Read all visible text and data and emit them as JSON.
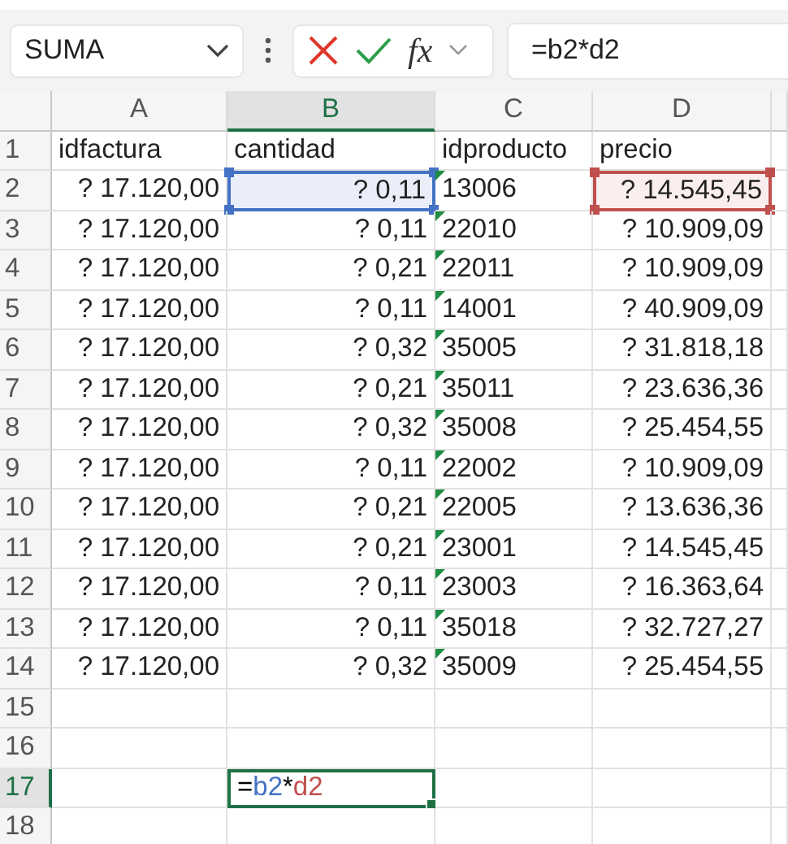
{
  "toolbar": {
    "name_box": "SUMA",
    "function_label": "fx",
    "formula": "=b2*d2"
  },
  "columns": [
    {
      "label": "A",
      "selected": false
    },
    {
      "label": "B",
      "selected": true
    },
    {
      "label": "C",
      "selected": false
    },
    {
      "label": "D",
      "selected": false
    }
  ],
  "rows": [
    {
      "header": "1",
      "selected": false,
      "cells": [
        {
          "text": "idfactura",
          "kind": "text"
        },
        {
          "text": "cantidad",
          "kind": "text"
        },
        {
          "text": "idproducto",
          "kind": "text"
        },
        {
          "text": "precio",
          "kind": "text"
        }
      ]
    },
    {
      "header": "2",
      "selected": false,
      "cells": [
        {
          "text": "? 17.120,00",
          "kind": "number"
        },
        {
          "text": "? 0,11",
          "kind": "number",
          "color": "#4472c4"
        },
        {
          "text": "13006",
          "kind": "text",
          "flag": true
        },
        {
          "text": "? 14.545,45",
          "kind": "number",
          "color": "#c0504d"
        }
      ]
    },
    {
      "header": "3",
      "selected": false,
      "cells": [
        {
          "text": "? 17.120,00",
          "kind": "number"
        },
        {
          "text": "? 0,11",
          "kind": "number"
        },
        {
          "text": "22010",
          "kind": "text",
          "flag": true
        },
        {
          "text": "? 10.909,09",
          "kind": "number"
        }
      ]
    },
    {
      "header": "4",
      "selected": false,
      "cells": [
        {
          "text": "? 17.120,00",
          "kind": "number"
        },
        {
          "text": "? 0,21",
          "kind": "number"
        },
        {
          "text": "22011",
          "kind": "text",
          "flag": true
        },
        {
          "text": "? 10.909,09",
          "kind": "number"
        }
      ]
    },
    {
      "header": "5",
      "selected": false,
      "cells": [
        {
          "text": "? 17.120,00",
          "kind": "number"
        },
        {
          "text": "? 0,11",
          "kind": "number"
        },
        {
          "text": "14001",
          "kind": "text",
          "flag": true
        },
        {
          "text": "? 40.909,09",
          "kind": "number"
        }
      ]
    },
    {
      "header": "6",
      "selected": false,
      "cells": [
        {
          "text": "? 17.120,00",
          "kind": "number"
        },
        {
          "text": "? 0,32",
          "kind": "number"
        },
        {
          "text": "35005",
          "kind": "text",
          "flag": true
        },
        {
          "text": "? 31.818,18",
          "kind": "number"
        }
      ]
    },
    {
      "header": "7",
      "selected": false,
      "cells": [
        {
          "text": "? 17.120,00",
          "kind": "number"
        },
        {
          "text": "? 0,21",
          "kind": "number"
        },
        {
          "text": "35011",
          "kind": "text",
          "flag": true
        },
        {
          "text": "? 23.636,36",
          "kind": "number"
        }
      ]
    },
    {
      "header": "8",
      "selected": false,
      "cells": [
        {
          "text": "? 17.120,00",
          "kind": "number"
        },
        {
          "text": "? 0,32",
          "kind": "number"
        },
        {
          "text": "35008",
          "kind": "text",
          "flag": true
        },
        {
          "text": "? 25.454,55",
          "kind": "number"
        }
      ]
    },
    {
      "header": "9",
      "selected": false,
      "cells": [
        {
          "text": "? 17.120,00",
          "kind": "number"
        },
        {
          "text": "? 0,11",
          "kind": "number"
        },
        {
          "text": "22002",
          "kind": "text",
          "flag": true
        },
        {
          "text": "? 10.909,09",
          "kind": "number"
        }
      ]
    },
    {
      "header": "10",
      "selected": false,
      "cells": [
        {
          "text": "? 17.120,00",
          "kind": "number"
        },
        {
          "text": "? 0,21",
          "kind": "number"
        },
        {
          "text": "22005",
          "kind": "text",
          "flag": true
        },
        {
          "text": "? 13.636,36",
          "kind": "number"
        }
      ]
    },
    {
      "header": "11",
      "selected": false,
      "cells": [
        {
          "text": "? 17.120,00",
          "kind": "number"
        },
        {
          "text": "? 0,21",
          "kind": "number"
        },
        {
          "text": "23001",
          "kind": "text",
          "flag": true
        },
        {
          "text": "? 14.545,45",
          "kind": "number"
        }
      ]
    },
    {
      "header": "12",
      "selected": false,
      "cells": [
        {
          "text": "? 17.120,00",
          "kind": "number"
        },
        {
          "text": "? 0,11",
          "kind": "number"
        },
        {
          "text": "23003",
          "kind": "text",
          "flag": true
        },
        {
          "text": "? 16.363,64",
          "kind": "number"
        }
      ]
    },
    {
      "header": "13",
      "selected": false,
      "cells": [
        {
          "text": "? 17.120,00",
          "kind": "number"
        },
        {
          "text": "? 0,11",
          "kind": "number"
        },
        {
          "text": "35018",
          "kind": "text",
          "flag": true
        },
        {
          "text": "? 32.727,27",
          "kind": "number"
        }
      ]
    },
    {
      "header": "14",
      "selected": false,
      "cells": [
        {
          "text": "? 17.120,00",
          "kind": "number"
        },
        {
          "text": "? 0,32",
          "kind": "number"
        },
        {
          "text": "35009",
          "kind": "text",
          "flag": true
        },
        {
          "text": "? 25.454,55",
          "kind": "number"
        }
      ]
    },
    {
      "header": "15",
      "selected": false,
      "cells": []
    },
    {
      "header": "16",
      "selected": false,
      "cells": []
    },
    {
      "header": "17",
      "selected": true,
      "cells": [
        {
          "kind": "empty"
        },
        {
          "kind": "editing",
          "active": true,
          "tokens": [
            {
              "text": "=",
              "color": "#000000"
            },
            {
              "text": "b2",
              "color": "#4472c4"
            },
            {
              "text": "*",
              "color": "#000000"
            },
            {
              "text": "d2",
              "color": "#c0504d"
            }
          ]
        }
      ]
    },
    {
      "header": "18",
      "selected": false,
      "cells": []
    }
  ]
}
